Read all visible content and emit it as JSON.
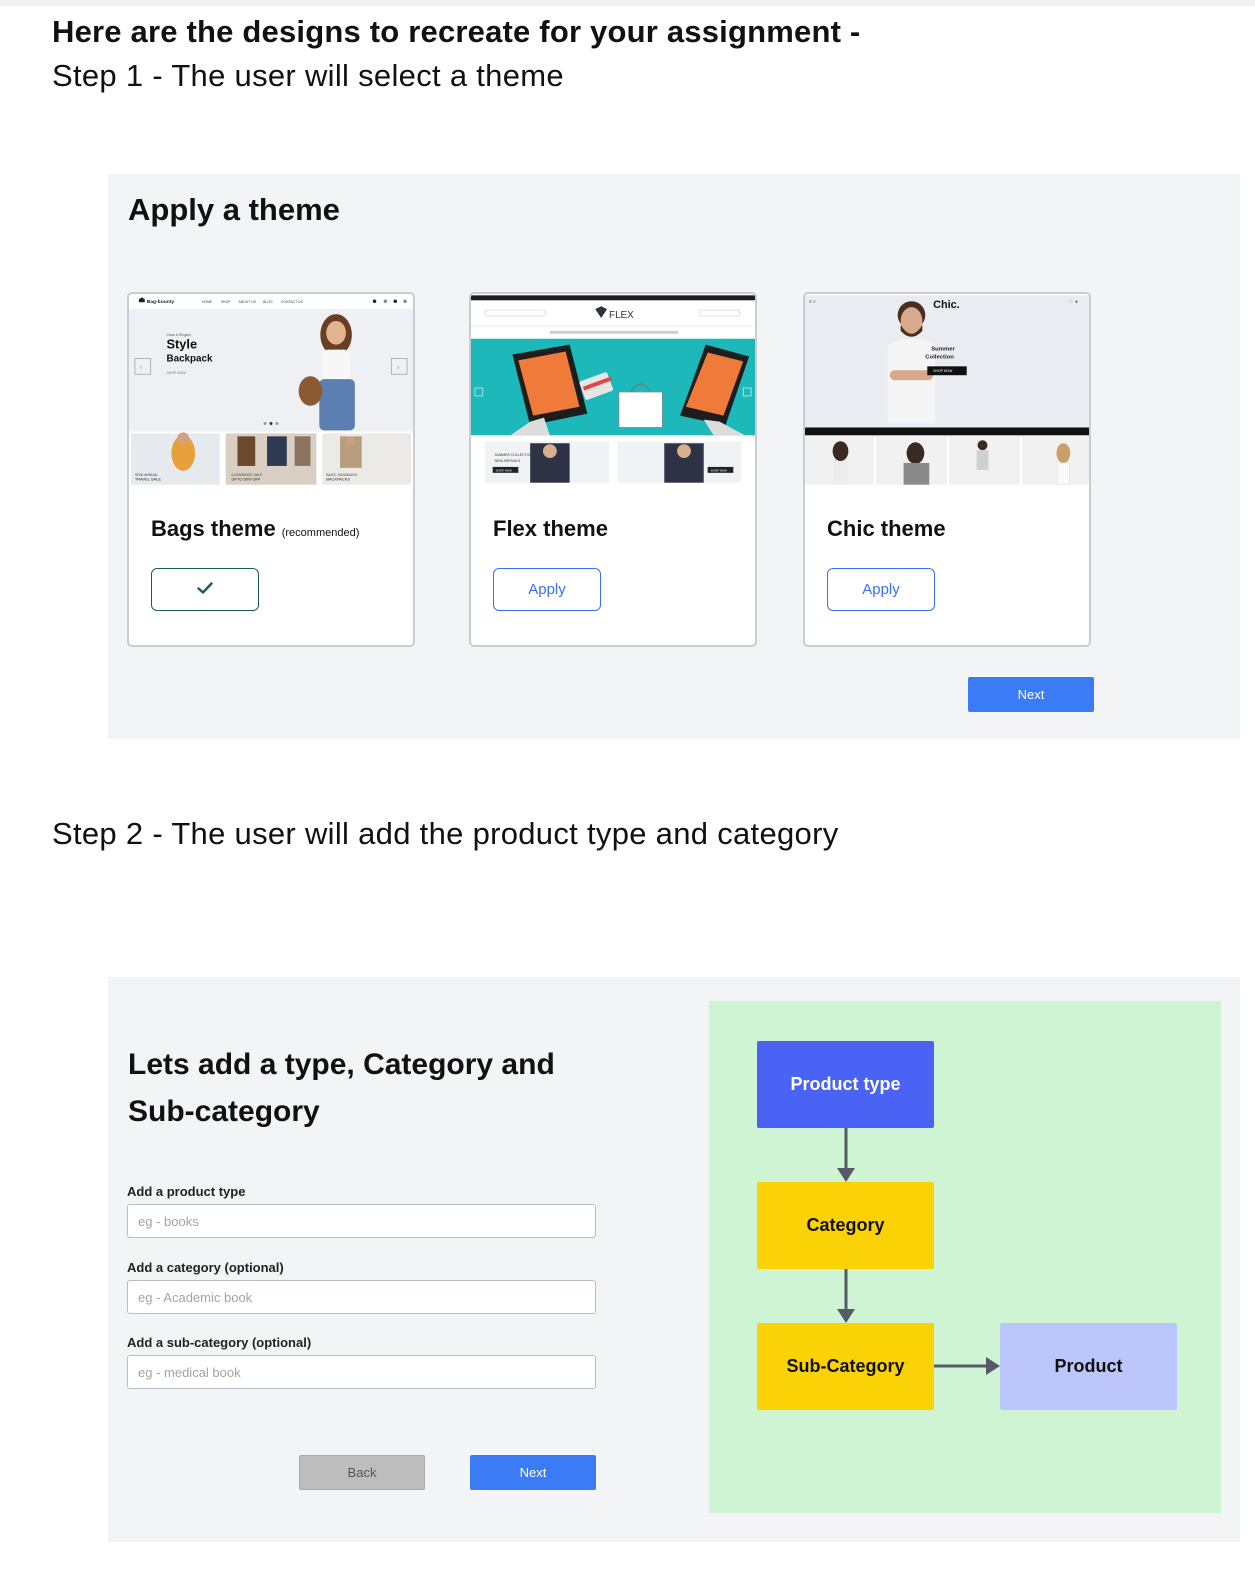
{
  "intro": {
    "heading": "Here are the designs to recreate for your assignment -",
    "step1": "Step 1 - The user will select a theme",
    "step2": "Step 2 - The user will add the product type and category"
  },
  "theme_panel": {
    "heading": "Apply a theme",
    "themes": [
      {
        "name": "Bags theme",
        "note": "(recommended)",
        "selected": true,
        "preview": {
          "brand": "Bag-bounty",
          "nav": [
            "HOME",
            "SHOP",
            "ABOUT US",
            "BLOG",
            "CONTACT US"
          ],
          "eyebrow": "Clear & Elegant",
          "headline": "Style",
          "subline": "Backpack",
          "cta": "SHOP NOW",
          "tiles": [
            {
              "label1": "SEMI ANNUAL",
              "label2": "TRAVEL SALE"
            },
            {
              "label1": "CLEARANCE SALE",
              "label2": "UPTO 50% OFF"
            },
            {
              "label1": "BAGS, HANDBAGS",
              "label2": "BACKPACKS"
            }
          ]
        }
      },
      {
        "name": "Flex theme",
        "button": "Apply",
        "selected": false,
        "preview": {
          "logo": "FLEX",
          "tile_cta": "SHOP NOW",
          "tile_labels": [
            "SUMMER COLLECTION",
            "NEW ARRIVALS",
            "SHOP NOW"
          ]
        }
      },
      {
        "name": "Chic theme",
        "button": "Apply",
        "selected": false,
        "preview": {
          "logo": "Chic.",
          "headline_line1": "Summer",
          "headline_line2": "Collection",
          "cta": "SHOP NOW"
        }
      }
    ],
    "next": "Next"
  },
  "type_panel": {
    "heading": "Lets add a type, Category and Sub-category",
    "fields": [
      {
        "label": "Add a product type",
        "placeholder": "eg - books"
      },
      {
        "label": "Add a category (optional)",
        "placeholder": "eg - Academic book"
      },
      {
        "label": "Add a sub-category (optional)",
        "placeholder": "eg - medical book"
      }
    ],
    "back": "Back",
    "next": "Next",
    "diagram": {
      "product_type": "Product type",
      "category": "Category",
      "sub_category": "Sub-Category",
      "product": "Product"
    }
  },
  "colors": {
    "accent_blue": "#3b7bf5",
    "selected_green": "#1d5b56",
    "diagram_bg": "#cef4d4",
    "type_box": "#4a63f5",
    "category_box": "#fbd205",
    "product_box": "#bcc6fa"
  }
}
